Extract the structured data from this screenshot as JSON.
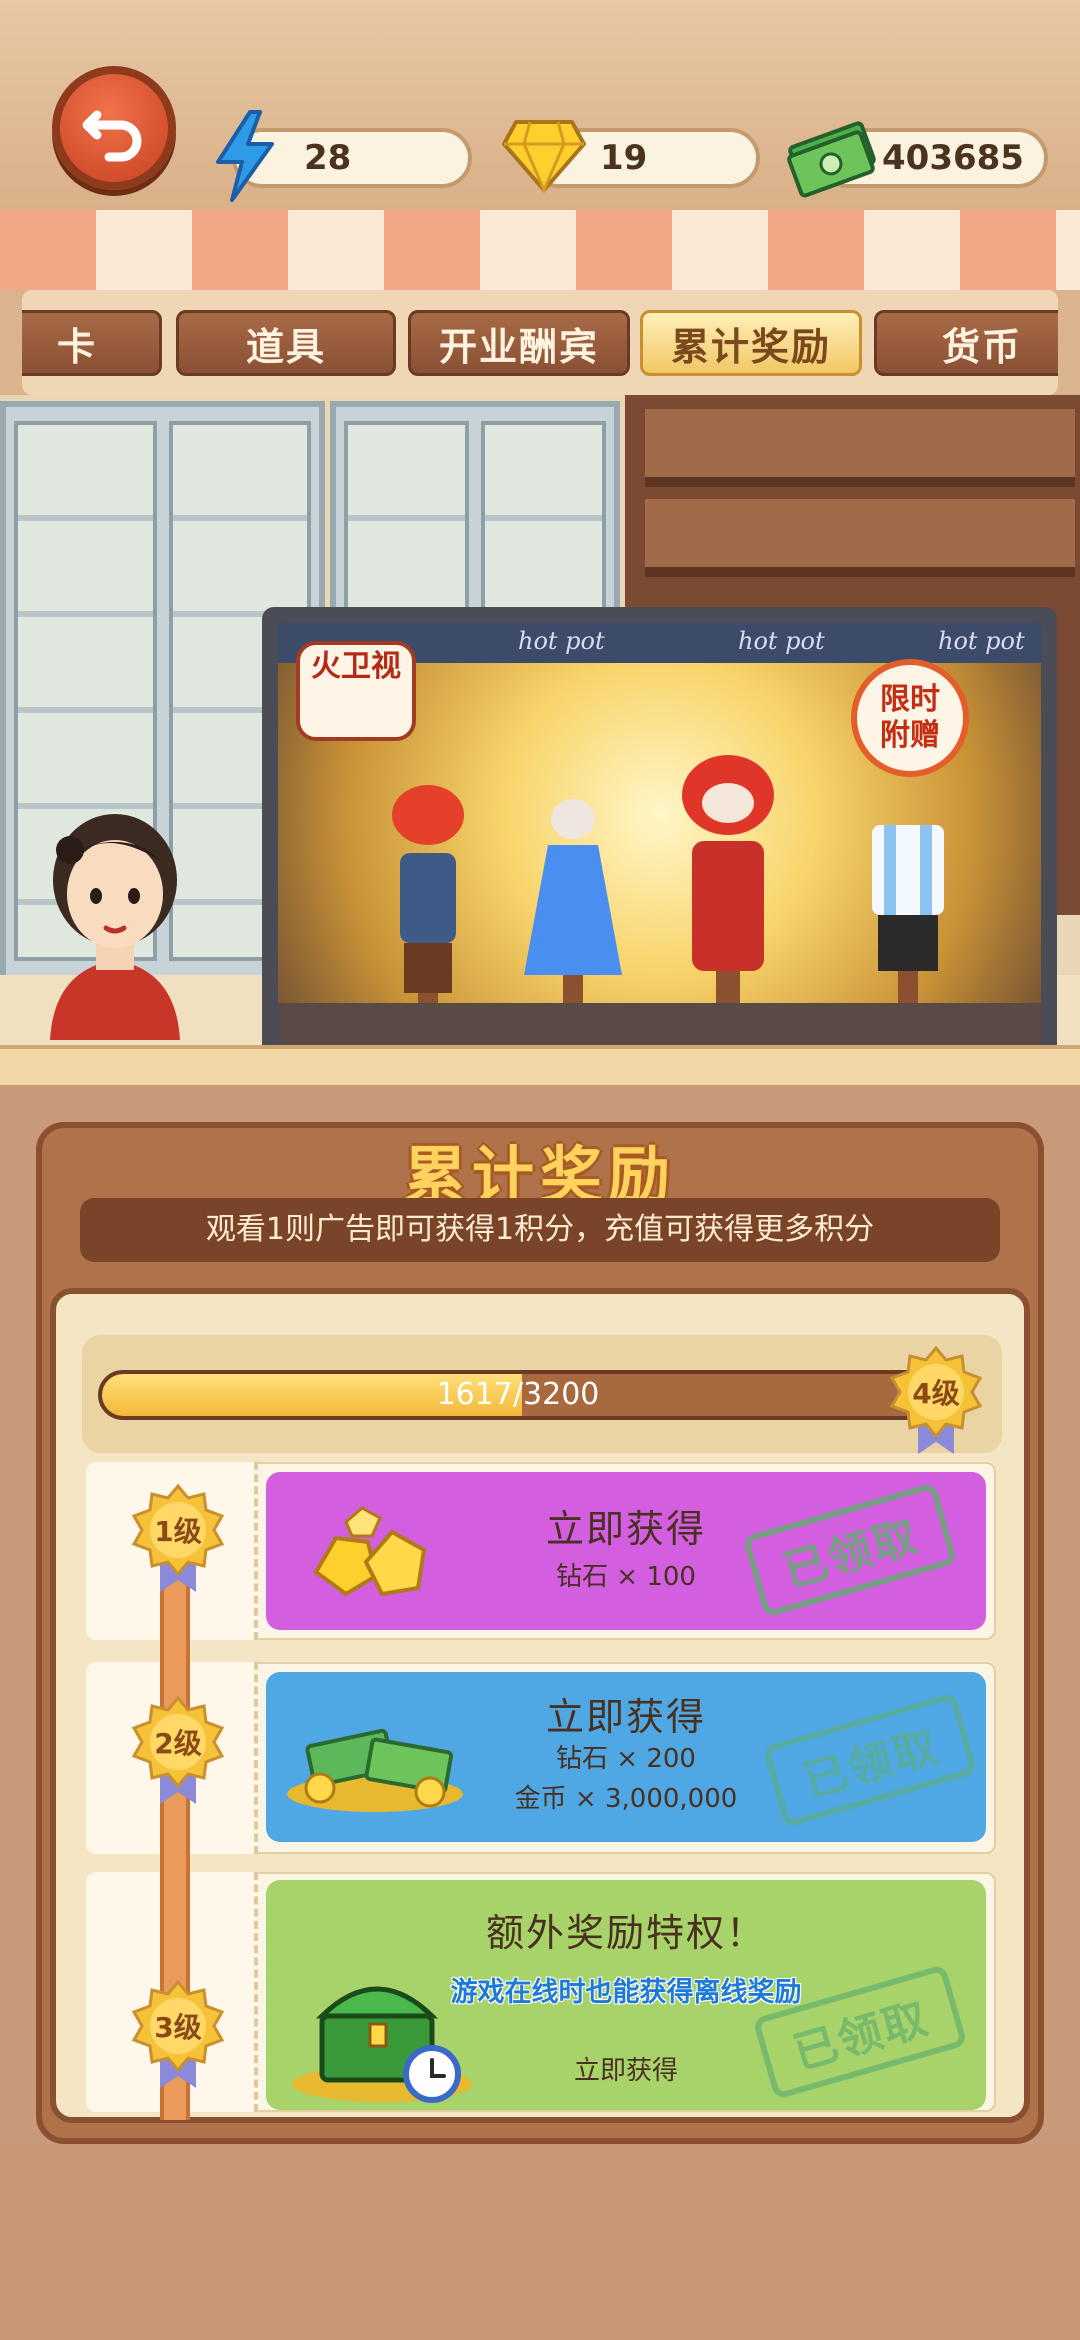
{
  "resources": {
    "energy": "28",
    "diamonds": "19",
    "cash": "403685"
  },
  "tabs": [
    {
      "label": "卡"
    },
    {
      "label": "道具"
    },
    {
      "label": "开业酬宾"
    },
    {
      "label": "累计奖励",
      "active": true
    },
    {
      "label": "货币"
    }
  ],
  "tv": {
    "channel_badge": "火卫视",
    "banner_text": "hot pot",
    "promo_line1": "限时",
    "promo_line2": "附赠"
  },
  "panel": {
    "title": "累计奖励",
    "subtitle": "观看1则广告即可获得1积分，充值可获得更多积分",
    "progress": {
      "text": "1617/3200",
      "current": 1617,
      "max": 3200,
      "level_label": "4级"
    },
    "rewards": [
      {
        "level": "1级",
        "title": "立即获得",
        "lines": [
          "钻石 × 100"
        ],
        "status": "已领取",
        "color": "#d35ee0"
      },
      {
        "level": "2级",
        "title": "立即获得",
        "lines": [
          "钻石 × 200",
          "金币 × 3,000,000"
        ],
        "status": "已领取",
        "color": "#4fa8e3"
      },
      {
        "level": "3级",
        "title": "额外奖励特权！",
        "highlight": "游戏在线时也能获得离线奖励",
        "lines": [
          "立即获得"
        ],
        "status": "已领取",
        "color": "#a8d26a"
      }
    ]
  },
  "colors": {
    "accent_gold": "#f3b83a",
    "panel_brown": "#b0724a",
    "stamp_green": "#5fae6e"
  }
}
